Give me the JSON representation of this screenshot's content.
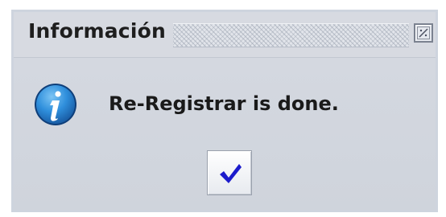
{
  "dialog": {
    "title": "Información",
    "message": "Re-Registrar is done."
  },
  "icons": {
    "info": "info-icon",
    "close": "close-icon",
    "ok": "checkmark-icon"
  },
  "colors": {
    "info_icon_fill": "#2f8fdc",
    "checkmark": "#1c1bcc"
  }
}
